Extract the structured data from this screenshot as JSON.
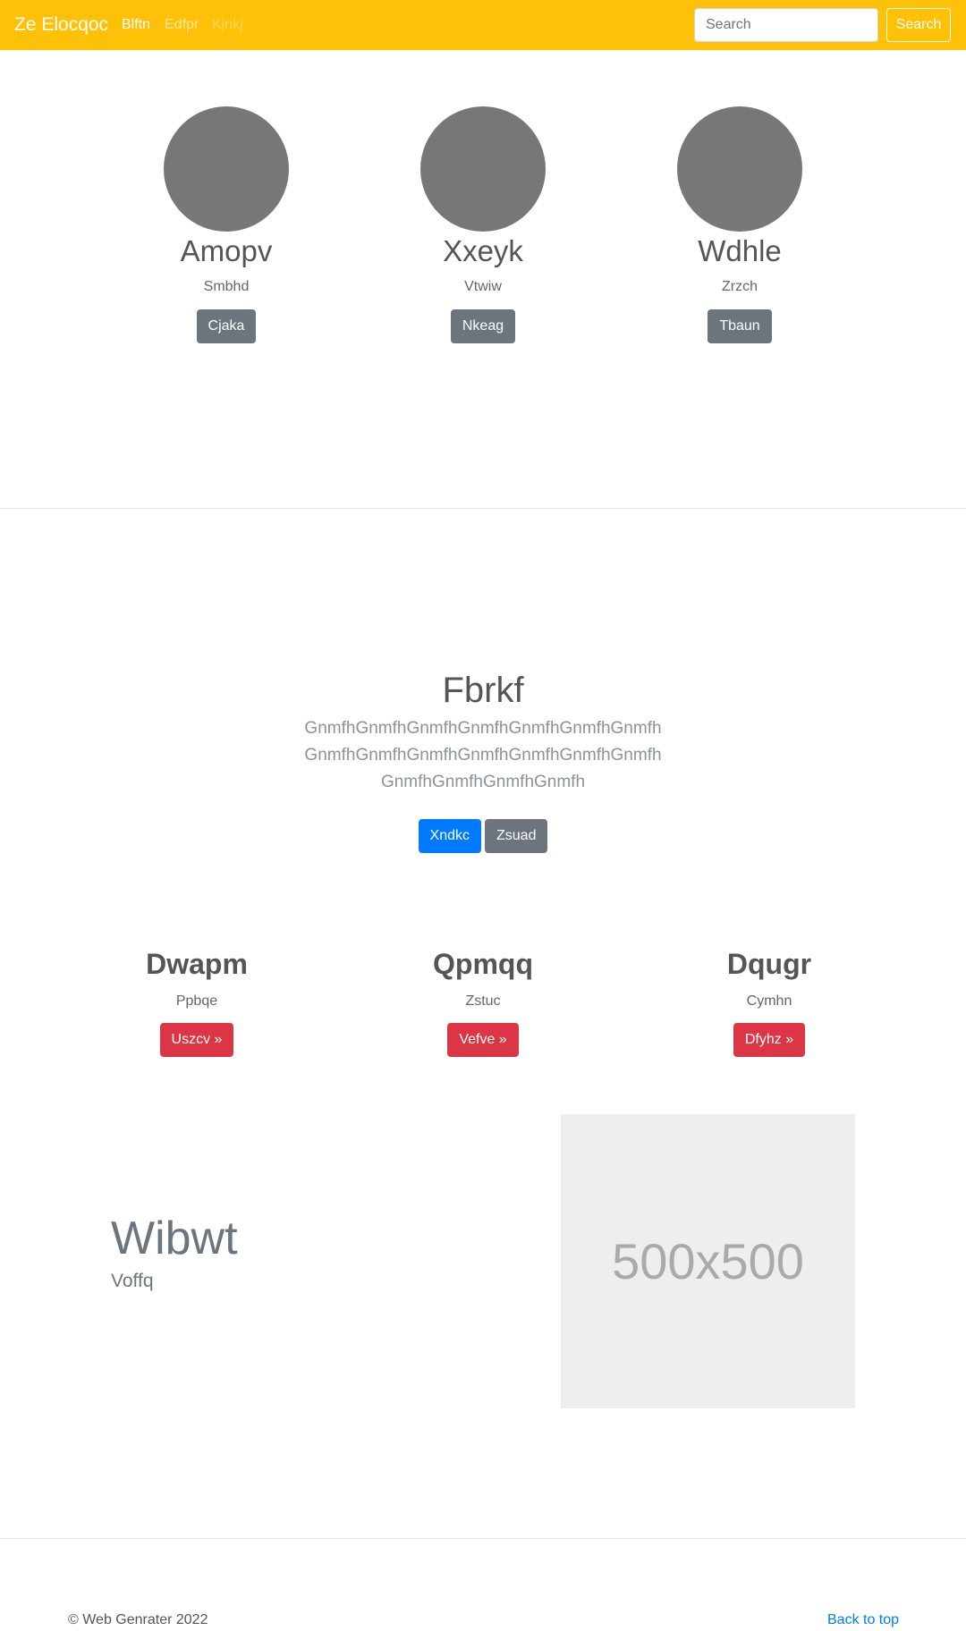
{
  "navbar": {
    "brand": "Ze Elocqoc",
    "links": [
      "Blftn",
      "Edfpr",
      "Kjnkj"
    ],
    "search_placeholder": "Search",
    "search_button": "Search"
  },
  "profiles": [
    {
      "name": "Amopv",
      "subtitle": "Smbhd",
      "button": "Cjaka"
    },
    {
      "name": "Xxeyk",
      "subtitle": "Vtwiw",
      "button": "Nkeag"
    },
    {
      "name": "Wdhle",
      "subtitle": "Zrzch",
      "button": "Tbaun"
    }
  ],
  "jumbotron": {
    "title": "Fbrkf",
    "text": "GnmfhGnmfhGnmfhGnmfhGnmfhGnmfhGnmfhGnmfhGnmfhGnmfhGnmfhGnmfhGnmfhGnmfhGnmfhGnmfhGnmfhGnmfh",
    "primary_button": "Xndkc",
    "secondary_button": "Zsuad"
  },
  "features": [
    {
      "title": "Dwapm",
      "subtitle": "Ppbqe",
      "button": "Uszcv »"
    },
    {
      "title": "Qpmqq",
      "subtitle": "Zstuc",
      "button": "Vefve »"
    },
    {
      "title": "Dqugr",
      "subtitle": "Cymhn",
      "button": "Dfyhz »"
    }
  ],
  "featurette": {
    "heading": "Wibwt",
    "subheading": "Voffq",
    "image_label": "500x500"
  },
  "footer": {
    "copyright": "© Web Genrater 2022",
    "back_to_top": "Back to top"
  },
  "colors": {
    "navbar": "#ffc107",
    "primary": "#007bff",
    "secondary": "#6c757d",
    "danger": "#dc3545",
    "avatar": "#777777",
    "placeholder": "#eeeeee"
  }
}
